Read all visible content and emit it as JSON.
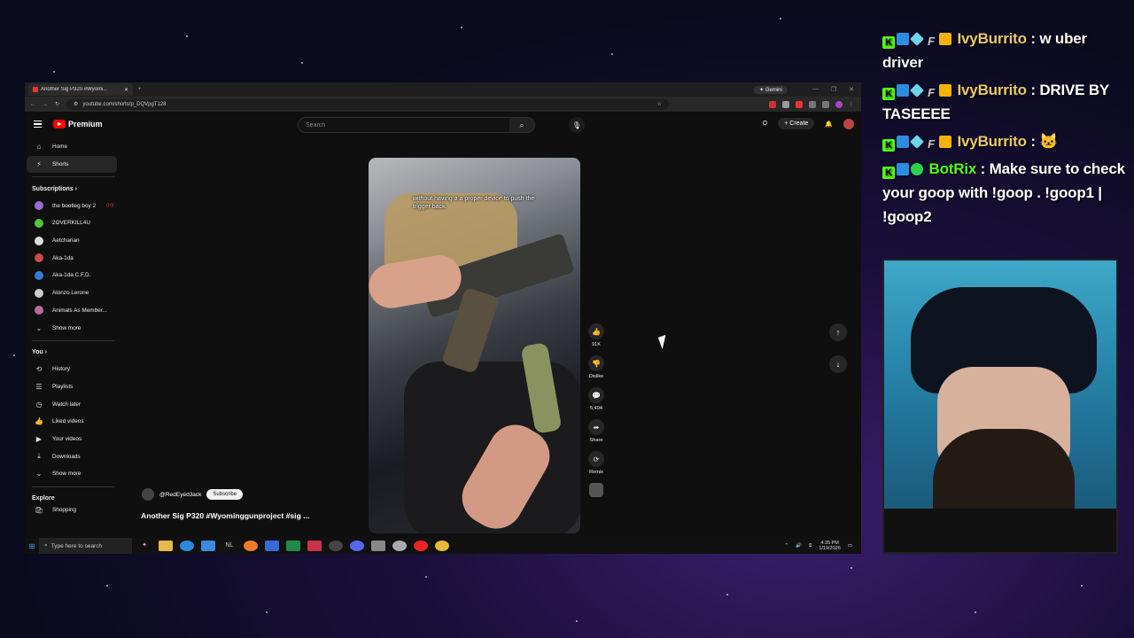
{
  "browser": {
    "tab_title": "Another Sig P320 #Wyomi...",
    "gemini_label": "Gemini",
    "url": "youtube.com/shorts/p_DQVpgT128"
  },
  "youtube": {
    "logo_text": "Premium",
    "search_placeholder": "Search",
    "create_label": "Create",
    "nav": [
      {
        "label": "Home",
        "icon": "home-icon"
      },
      {
        "label": "Shorts",
        "icon": "shorts-icon"
      }
    ],
    "subscriptions_heading": "Subscriptions",
    "subscriptions": [
      {
        "label": "the bootleg boy 2",
        "color": "#9a6bd8",
        "live": true
      },
      {
        "label": "2OVERKILL4U",
        "color": "#53c43a",
        "live": false
      },
      {
        "label": "Aetcharian",
        "color": "#dddddd",
        "live": false
      },
      {
        "label": "Aka-1da",
        "color": "#c94a4a",
        "live": false
      },
      {
        "label": "Aka-1da C.F.D.",
        "color": "#3a7ad8",
        "live": false
      },
      {
        "label": "Alonzo Lerone",
        "color": "#cccccc",
        "live": false
      },
      {
        "label": "Animals As Member...",
        "color": "#b86a9e",
        "live": false
      }
    ],
    "show_more": "Show more",
    "you_heading": "You",
    "you_items": [
      {
        "label": "History",
        "icon": "history-icon"
      },
      {
        "label": "Playlists",
        "icon": "playlists-icon"
      },
      {
        "label": "Watch later",
        "icon": "clock-icon"
      },
      {
        "label": "Liked videos",
        "icon": "thumb-up-icon"
      },
      {
        "label": "Your videos",
        "icon": "video-icon"
      },
      {
        "label": "Downloads",
        "icon": "download-icon"
      }
    ],
    "show_more_2": "Show more",
    "explore_heading": "Explore",
    "explore_cut": "Shopping",
    "short": {
      "caption": "without having a a proper device to push the trigger back.",
      "likes": "91K",
      "dislike_label": "Dislike",
      "comments": "5,494",
      "share_label": "Share",
      "remix_label": "Remix",
      "channel": "@RedEyedJack",
      "subscribe_label": "Subscribe",
      "title": "Another Sig P320 #Wyominggunproject #sig ..."
    }
  },
  "taskbar": {
    "search_placeholder": "Type here to search",
    "time": "4:35 PM",
    "date": "1/19/2026"
  },
  "chat": {
    "messages": [
      {
        "user": "IvyBurrito",
        "text": " : w uber driver",
        "bot": false
      },
      {
        "user": "IvyBurrito",
        "text": " : DRIVE BY TASEEEE",
        "bot": false
      },
      {
        "user": "IvyBurrito",
        "text": " : 🐱",
        "bot": false
      },
      {
        "user": "BotRix",
        "text": " : Make sure to check your goop with !goop . !goop1 | !goop2",
        "bot": true
      }
    ]
  }
}
